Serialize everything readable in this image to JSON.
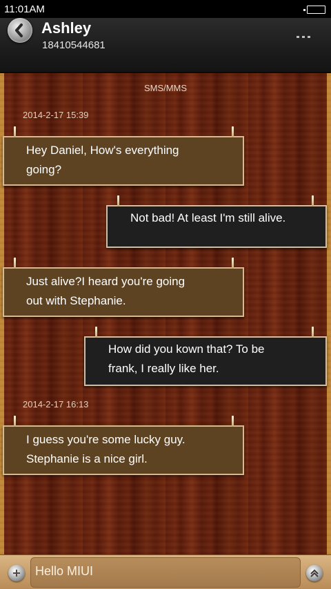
{
  "status_bar": {
    "time": "11:01AM"
  },
  "header": {
    "name": "Ashley",
    "number": "18410544681"
  },
  "conversation": {
    "label": "SMS/MMS",
    "timestamps": [
      "2014-2-17 15:39",
      "2014-2-17 16:13"
    ],
    "messages": [
      {
        "dir": "in",
        "lines": [
          "Hey Daniel, How's everything",
          "going?"
        ]
      },
      {
        "dir": "out",
        "lines": [
          "Not bad! At least I'm still alive."
        ]
      },
      {
        "dir": "in",
        "lines": [
          "Just  alive?I heard you're going",
          "out with Stephanie."
        ]
      },
      {
        "dir": "out",
        "lines": [
          "How did you kown that? To be",
          "frank, I really like her."
        ]
      },
      {
        "dir": "in",
        "lines": [
          "I guess you're some lucky guy.",
          "Stephanie is a nice girl."
        ]
      }
    ]
  },
  "composer": {
    "text": "Hello MIUI"
  },
  "colors": {
    "incoming_bubble": "#5e4323",
    "outgoing_bubble": "#1f1f1f",
    "wood": "#6e2710"
  }
}
